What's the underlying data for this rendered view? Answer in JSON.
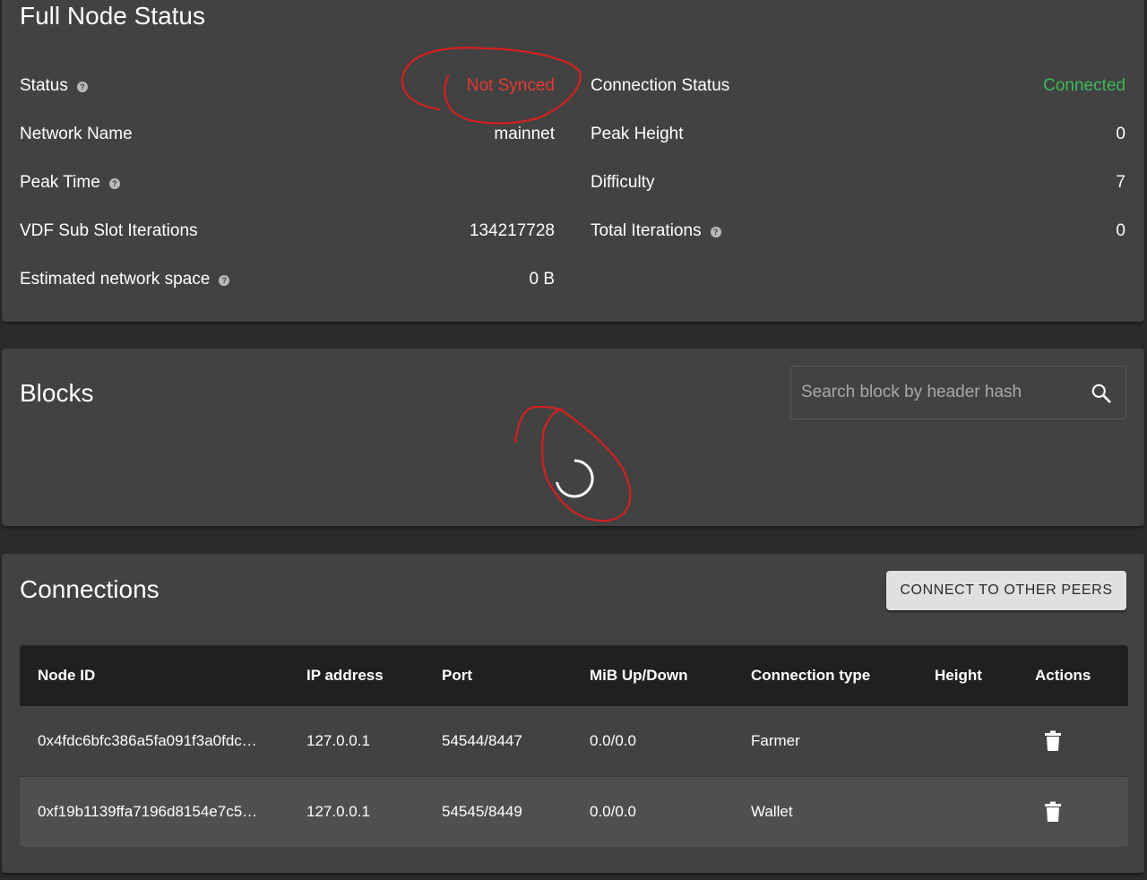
{
  "full_node_status": {
    "title": "Full Node Status",
    "left": [
      {
        "label": "Status",
        "value": "Not Synced",
        "help": true,
        "value_color": "#e53935"
      },
      {
        "label": "Network Name",
        "value": "mainnet",
        "help": false
      },
      {
        "label": "Peak Time",
        "value": "",
        "help": true
      },
      {
        "label": "VDF Sub Slot Iterations",
        "value": "134217728",
        "help": false
      },
      {
        "label": "Estimated network space",
        "value": "0 B",
        "help": true
      }
    ],
    "right": [
      {
        "label": "Connection Status",
        "value": "Connected",
        "help": false,
        "value_color": "#3db85a"
      },
      {
        "label": "Peak Height",
        "value": "0",
        "help": false
      },
      {
        "label": "Difficulty",
        "value": "7",
        "help": false
      },
      {
        "label": "Total Iterations",
        "value": "0",
        "help": true
      }
    ]
  },
  "blocks": {
    "title": "Blocks",
    "search_placeholder": "Search block by header hash"
  },
  "connections": {
    "title": "Connections",
    "connect_button": "CONNECT TO OTHER PEERS",
    "columns": [
      "Node ID",
      "IP address",
      "Port",
      "MiB Up/Down",
      "Connection type",
      "Height",
      "Actions"
    ],
    "rows": [
      {
        "node_id": "0x4fdc6bfc386a5fa091f3a0fdc…",
        "ip": "127.0.0.1",
        "port": "54544/8447",
        "mib": "0.0/0.0",
        "type": "Farmer",
        "height": ""
      },
      {
        "node_id": "0xf19b1139ffa7196d8154e7c5…",
        "ip": "127.0.0.1",
        "port": "54545/8449",
        "mib": "0.0/0.0",
        "type": "Wallet",
        "height": ""
      }
    ]
  },
  "colors": {
    "background": "#2b2b2b",
    "card": "#424242",
    "annotation": "#d42020",
    "not_synced": "#e53935",
    "connected": "#3db85a"
  }
}
